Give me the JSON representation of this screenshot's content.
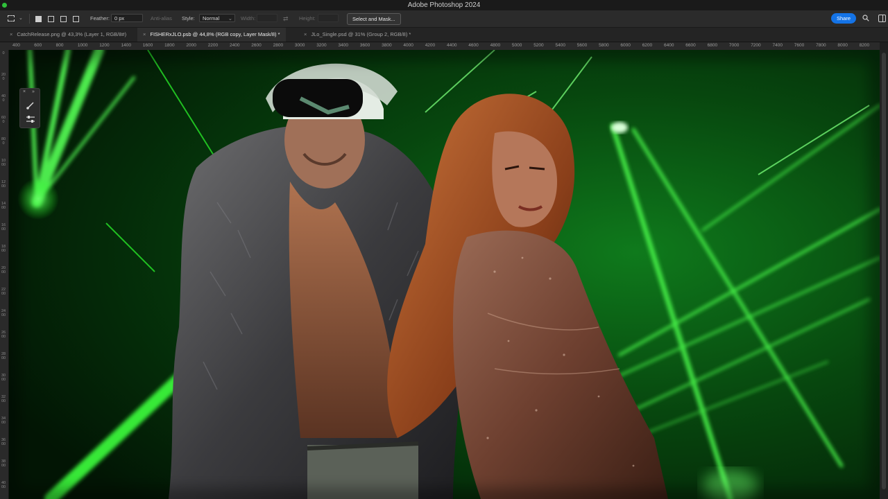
{
  "app": {
    "title": "Adobe Photoshop 2024"
  },
  "options": {
    "feather_label": "Feather:",
    "feather_value": "0 px",
    "anti_alias_label": "Anti-alias",
    "style_label": "Style:",
    "style_value": "Normal",
    "width_label": "Width:",
    "height_label": "Height:",
    "select_mask_label": "Select and Mask...",
    "share_label": "Share"
  },
  "tabs": [
    {
      "label": "CatchRelease.png @ 43,3% (Layer 1, RGB/8#)",
      "active": false
    },
    {
      "label": "FISHERxJLO.psb @ 44,8% (RGB copy, Layer Mask/8) *",
      "active": true
    },
    {
      "label": "JLo_Single.psd @ 31% (Group 2, RGB/8) *",
      "active": false
    }
  ],
  "ruler": {
    "h_ticks": [
      "400",
      "600",
      "800",
      "1000",
      "1200",
      "1400",
      "1600",
      "1800",
      "2000",
      "2200",
      "2400",
      "2600",
      "2800",
      "3000",
      "3200",
      "3400",
      "3600",
      "3800",
      "4000",
      "4200",
      "4400",
      "4600",
      "4800",
      "5000",
      "5200",
      "5400",
      "5600",
      "5800",
      "6000",
      "6200",
      "6400",
      "6600",
      "6800",
      "7000",
      "7200",
      "7400",
      "7600",
      "7800",
      "8000",
      "8200"
    ],
    "v_ticks": [
      "0",
      "200",
      "400",
      "600",
      "800",
      "1000",
      "1200",
      "1400",
      "1600",
      "1800",
      "2000",
      "2200",
      "2400",
      "2600",
      "2800",
      "3000",
      "3200",
      "3400",
      "3600",
      "3800",
      "4000"
    ]
  },
  "icons": {
    "marquee": "rect-marquee-icon",
    "search": "search-icon",
    "panels": "panels-icon",
    "brush": "brush-icon",
    "sliders": "sliders-icon"
  },
  "colors": {
    "accent": "#1473e6",
    "laser": "#39ff3a"
  }
}
